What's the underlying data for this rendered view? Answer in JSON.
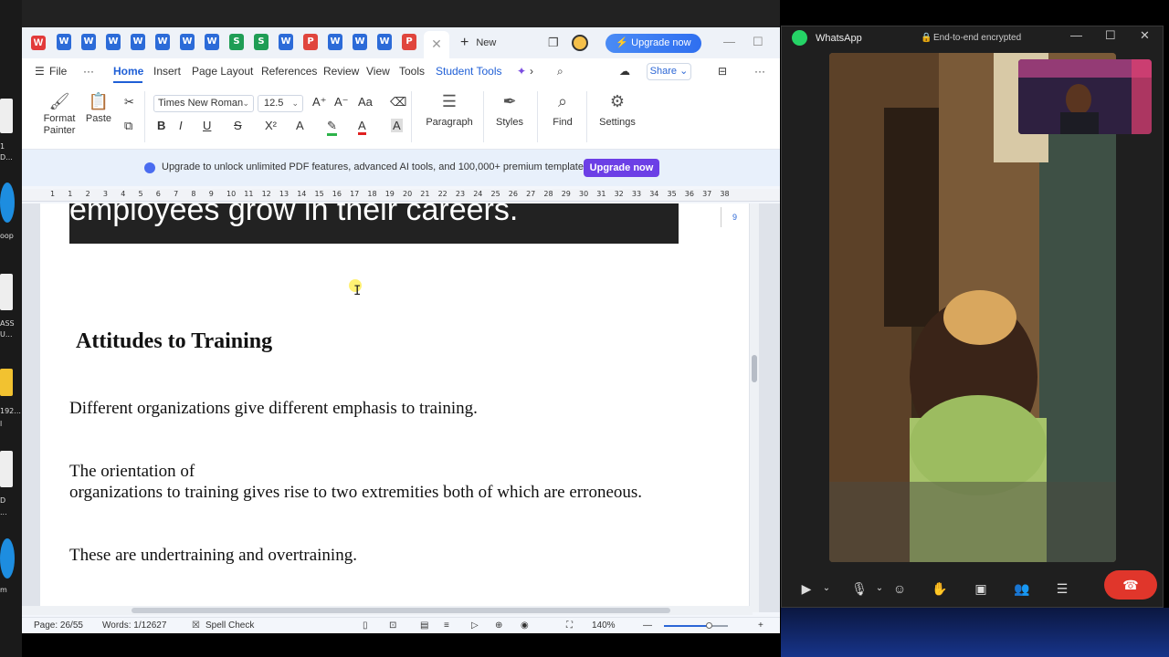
{
  "desktop": {
    "labels": [
      "1",
      "D...",
      "oop",
      "ASS",
      "U...",
      "192...",
      "l",
      "D",
      "...",
      "m"
    ]
  },
  "wps": {
    "tabs": [
      "W",
      "W",
      "W",
      "W",
      "W",
      "W",
      "W",
      "S",
      "S",
      "W",
      "P",
      "W",
      "W",
      "W",
      "P"
    ],
    "new_tab_label": "New",
    "upgrade_label": "Upgrade now",
    "menu": {
      "file": "File",
      "home": "Home",
      "insert": "Insert",
      "page_layout": "Page Layout",
      "references": "References",
      "review": "Review",
      "view": "View",
      "tools": "Tools",
      "student_tools": "Student Tools",
      "share": "Share"
    },
    "ribbon": {
      "format_painter": "Format Painter",
      "paste": "Paste",
      "font_name": "Times New Roman",
      "font_size": "12.5",
      "paragraph": "Paragraph",
      "styles": "Styles",
      "find": "Find",
      "settings": "Settings"
    },
    "promo": {
      "text": "Upgrade to unlock unlimited PDF features, advanced AI tools, and 100,000+ premium templates.",
      "button": "Upgrade now"
    },
    "ruler_numbers": [
      "1",
      "1",
      "2",
      "3",
      "4",
      "5",
      "6",
      "7",
      "8",
      "9",
      "10",
      "11",
      "12",
      "13",
      "14",
      "15",
      "16",
      "17",
      "18",
      "19",
      "20",
      "21",
      "22",
      "23",
      "24",
      "25",
      "26",
      "27",
      "28",
      "29",
      "30",
      "31",
      "32",
      "33",
      "34",
      "35",
      "36",
      "37",
      "38"
    ],
    "document": {
      "banner_text": "employees grow in their careers.",
      "heading": "Attitudes to Training",
      "p1": "Different organizations give different emphasis to training.",
      "p2_line1": "The orientation of",
      "p2_line2": "organizations to training gives rise to two extremities both of which are erroneous.",
      "p3": "These are undertraining and overtraining.",
      "side_marker": "9"
    },
    "status": {
      "page": "Page: 26/55",
      "words": "Words: 1/12627",
      "spell_check": "Spell Check",
      "zoom": "140%",
      "zoom_level": 0.7
    }
  },
  "whatsapp": {
    "app_name": "WhatsApp",
    "encryption": "End-to-end encrypted"
  }
}
